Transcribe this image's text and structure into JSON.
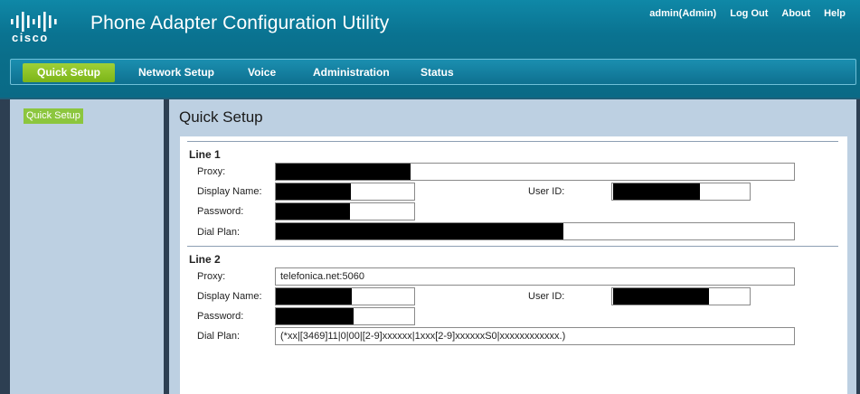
{
  "app": {
    "logo_text": "cisco",
    "title": "Phone Adapter Configuration Utility"
  },
  "top_links": {
    "user": "admin(Admin)",
    "logout": "Log Out",
    "about": "About",
    "help": "Help"
  },
  "nav": {
    "quick_setup": "Quick Setup",
    "network_setup": "Network Setup",
    "voice": "Voice",
    "administration": "Administration",
    "status": "Status"
  },
  "sidebar": {
    "quick_setup": "Quick Setup"
  },
  "page": {
    "title": "Quick Setup"
  },
  "labels": {
    "proxy": "Proxy:",
    "display_name": "Display Name:",
    "user_id": "User ID:",
    "password": "Password:",
    "dial_plan": "Dial Plan:"
  },
  "line1": {
    "title": "Line 1",
    "proxy": "",
    "display_name": "",
    "user_id": "",
    "password": "",
    "dial_plan": ""
  },
  "line2": {
    "title": "Line 2",
    "proxy": "telefonica.net:5060",
    "display_name": "",
    "user_id": "",
    "password": "",
    "dial_plan": "(*xx|[3469]11|0|00|[2-9]xxxxxx|1xxx[2-9]xxxxxxS0|xxxxxxxxxxxx.)"
  }
}
